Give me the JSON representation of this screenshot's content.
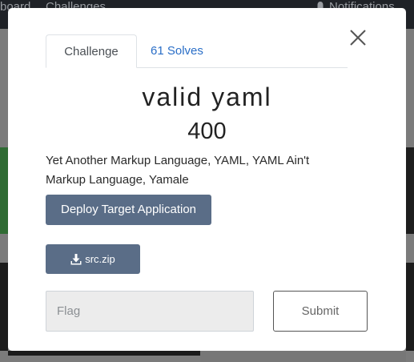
{
  "background": {
    "nav": {
      "item_left": "board",
      "item_challenges": "Challenges",
      "item_notifications": "Notifications"
    }
  },
  "modal": {
    "tabs": {
      "challenge_label": "Challenge",
      "solves_label": "61 Solves"
    },
    "close_icon": "close-icon",
    "challenge": {
      "name": "valid yaml",
      "points": "400",
      "description": "Yet Another Markup Language, YAML, YAML Ain't Markup Language, Yamale"
    },
    "deploy_button_label": "Deploy Target Application",
    "file": {
      "icon": "download-icon",
      "label": "src.zip"
    },
    "flag_input": {
      "placeholder": "Flag",
      "value": ""
    },
    "submit_label": "Submit"
  },
  "colors": {
    "primary_button": "#5a6d87",
    "link": "#2a6ec7"
  }
}
